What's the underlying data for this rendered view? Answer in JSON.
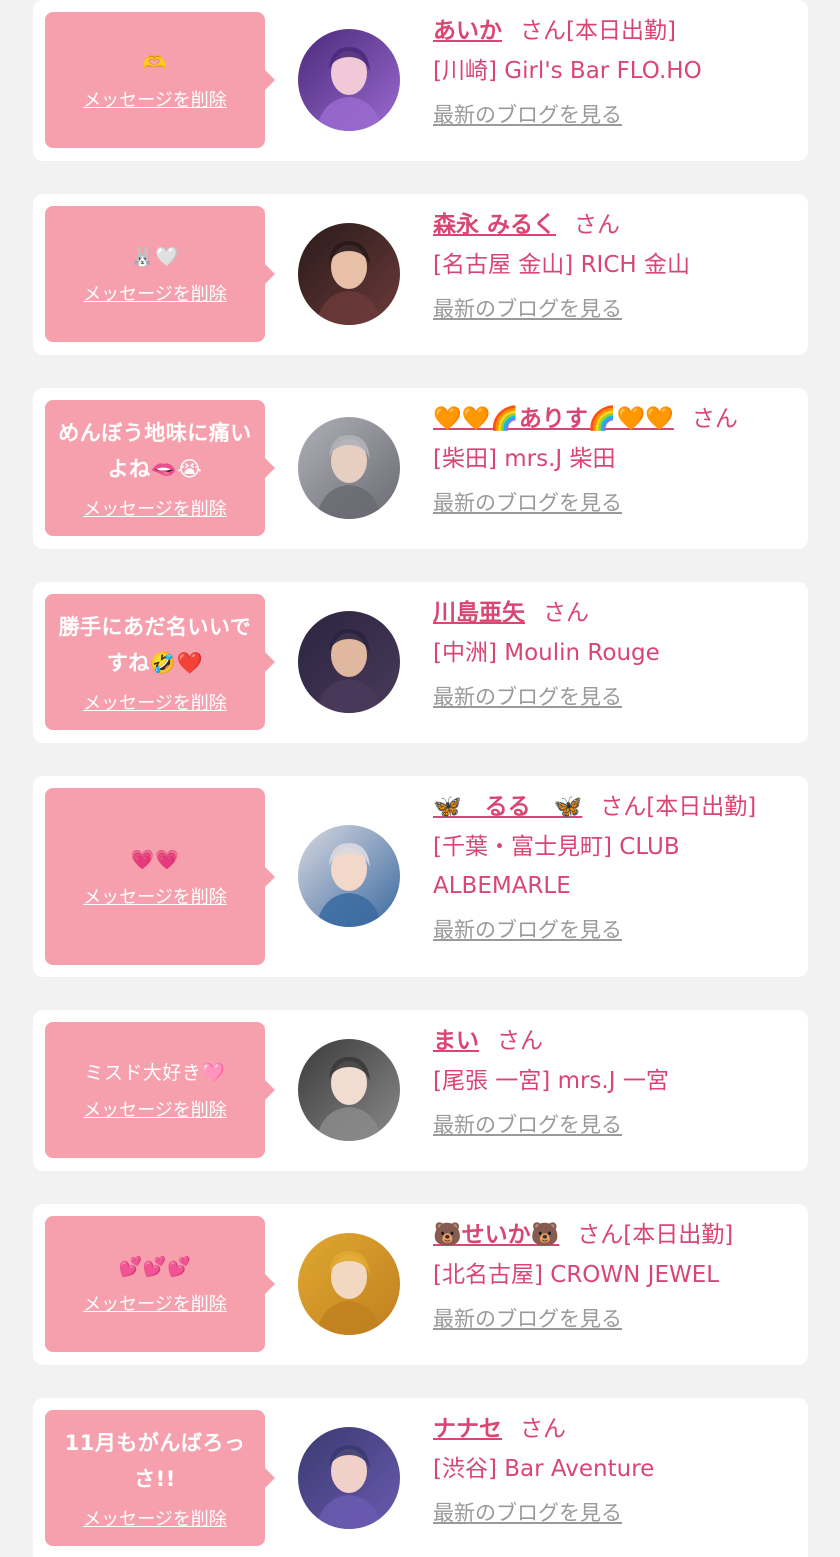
{
  "delete_label": "メッセージを削除",
  "san_suffix": "さん",
  "blog_label": "最新のブログを見る",
  "colors": {
    "page_bg": "#f2f2f2",
    "card_bg": "#ffffff",
    "bubble_bg": "#f7a0ad",
    "accent": "#d94674",
    "link_gray": "#9a9a9a"
  },
  "cards": [
    {
      "message": "🫶",
      "name": "あいか",
      "status": "[本日出勤]",
      "shop": "[川崎] Girl's Bar FLO.HO"
    },
    {
      "message": "🐰🤍",
      "name": "森永 みるく",
      "status": "",
      "shop": "[名古屋 金山] RICH 金山"
    },
    {
      "message": "めんぼう地味に痛いよね🫦😭",
      "name": "🧡🧡🌈ありす🌈🧡🧡",
      "status": "",
      "shop": "[柴田] mrs.J 柴田"
    },
    {
      "message": "勝手にあだ名いいですね🤣❤️",
      "name": "川島亜矢",
      "status": "",
      "shop": "[中洲] Moulin Rouge"
    },
    {
      "message": "💗💗",
      "name": "🦋　るる　🦋",
      "status": "[本日出勤]",
      "shop": "[千葉・富士見町] CLUB ALBEMARLE"
    },
    {
      "message": "ミスド大好き🩷",
      "name": "まい",
      "status": "",
      "shop": "[尾張 一宮] mrs.J 一宮"
    },
    {
      "message": "💕💕💕",
      "name": "🐻せいか🐻",
      "status": "[本日出勤]",
      "shop": "[北名古屋] CROWN JEWEL"
    },
    {
      "message": "11月もがんばろっさ!!",
      "name": "ナナセ",
      "status": "",
      "shop": "[渋谷] Bar Aventure"
    }
  ]
}
